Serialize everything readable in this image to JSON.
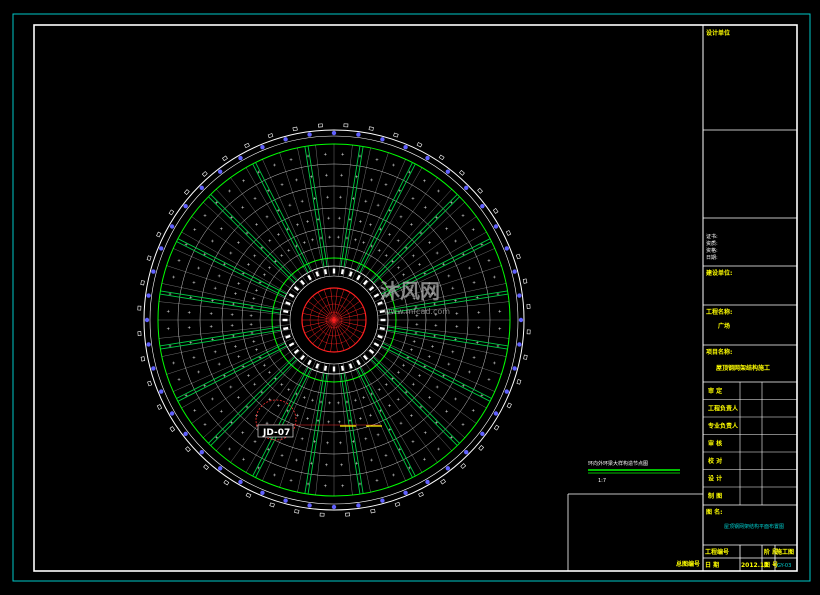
{
  "colors": {
    "background": "#000000",
    "border": "#ffffff",
    "outer_border": "#00c8c8",
    "ring_green": "#00ff00",
    "ring_white": "#ffffff",
    "beam_green": "#00cc44",
    "node_blue": "#6060ff",
    "center_red": "#ff2020",
    "callout_red": "#ff3030",
    "label_yellow": "#ffff00",
    "watermark": "#b0b0b0"
  },
  "drawing": {
    "callout_label": "JD-07",
    "watermark_brand": "沐风网",
    "watermark_url": "www.mfcad.com"
  },
  "legend": {
    "title": "环向外环梁大样构造节点图",
    "sub": "1:7"
  },
  "title_block": {
    "design_unit": "设计单位",
    "cert_lines": [
      "证书:",
      "资质:",
      "资格:",
      "日期:"
    ],
    "construction_unit_label": "建设单位:",
    "project_name_label": "工程名称:",
    "project_name_value": "广场",
    "item_name_label": "项目名称:",
    "item_name_value": "屋顶钢网架结构施工",
    "signatures": [
      "审 定",
      "工程负责人",
      "专业负责人",
      "审 核",
      "校 对",
      "设 计",
      "制 图"
    ],
    "drawing_name_label": "图 名:",
    "drawing_name_value": "屋顶钢网架结构平面布置图",
    "project_no_label": "工程编号",
    "date_label": "日 期",
    "date_value": "2012.12",
    "phase_label": "阶 段",
    "phase_value": "施工图",
    "sheet_label": "图 号",
    "sheet_value": "GY-03"
  },
  "bottom_left_label": "总图编号"
}
